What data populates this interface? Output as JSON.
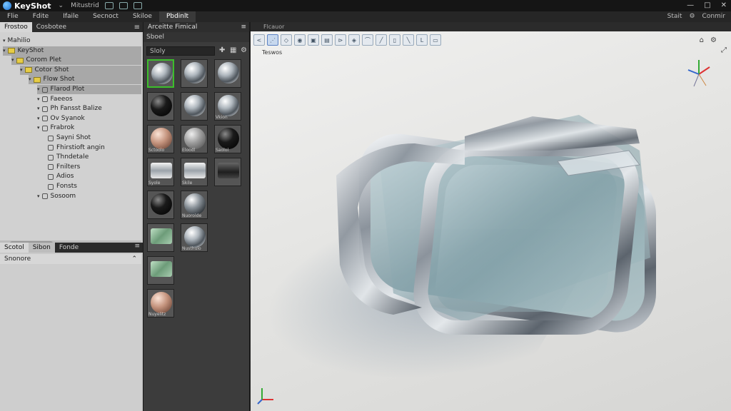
{
  "title_bar": {
    "app_name": "KeyShot",
    "items": [
      "Mitustrid"
    ],
    "right": [
      "□",
      "✕"
    ]
  },
  "menu": {
    "items": [
      "Flie",
      "Fdite",
      "Ifaile",
      "Secnoct",
      "Skiloe",
      "Pbdinlt"
    ],
    "active_index": 5,
    "right": [
      "Stait",
      "Conmir"
    ]
  },
  "scene_panel": {
    "tabs": [
      "Frostoo",
      "Cosbotee"
    ],
    "tree": [
      {
        "label": "Mahilio",
        "level": 0,
        "kind": "text"
      },
      {
        "label": "KeyShot",
        "level": 0,
        "kind": "folder",
        "selected": true
      },
      {
        "label": "Corom Plet",
        "level": 1,
        "kind": "folder",
        "selected": true
      },
      {
        "label": "Cotor Shot",
        "level": 2,
        "kind": "folder",
        "selected": true
      },
      {
        "label": "Flow Shot",
        "level": 3,
        "kind": "folder",
        "selected": true
      },
      {
        "label": "Flarod Plot",
        "level": 4,
        "kind": "item",
        "selected": true
      },
      {
        "label": "Faeeos",
        "level": 4,
        "kind": "item"
      },
      {
        "label": "Ph Fansst Balize",
        "level": 4,
        "kind": "item"
      },
      {
        "label": "Ov Syanok",
        "level": 4,
        "kind": "item"
      },
      {
        "label": "Frabrok",
        "level": 4,
        "kind": "item"
      },
      {
        "label": "Sayni Shot",
        "level": 5,
        "kind": "item"
      },
      {
        "label": "Fhirstioft angin",
        "level": 5,
        "kind": "item"
      },
      {
        "label": "Thndetale",
        "level": 5,
        "kind": "item"
      },
      {
        "label": "Fnilters",
        "level": 5,
        "kind": "item"
      },
      {
        "label": "Adios",
        "level": 5,
        "kind": "item"
      },
      {
        "label": "Fonsts",
        "level": 5,
        "kind": "item"
      },
      {
        "label": "Sosoom",
        "level": 4,
        "kind": "item"
      }
    ],
    "lower_tabs": [
      "Scotol",
      "Sibon",
      "Fonde"
    ],
    "props_title": "Snonore"
  },
  "library": {
    "tab_label": "Arceitte Fimical",
    "sub_label": "Sboel",
    "search_placeholder": "Sloly",
    "materials": [
      {
        "label": "",
        "style": "chrome",
        "selected": true
      },
      {
        "label": "",
        "style": "chrome"
      },
      {
        "label": "",
        "style": "chrome"
      },
      {
        "label": "",
        "style": "black"
      },
      {
        "label": "",
        "style": "chrome"
      },
      {
        "label": "Vkion",
        "style": "chrome"
      },
      {
        "label": "Sctoolo",
        "style": "copper"
      },
      {
        "label": "Eloodl",
        "style": "grey"
      },
      {
        "label": "Saolol",
        "style": "black"
      },
      {
        "label": "Syole",
        "style": "plate"
      },
      {
        "label": "Skile",
        "style": "plate"
      },
      {
        "label": "",
        "style": "darkplate"
      },
      {
        "label": "",
        "style": "black"
      },
      {
        "label": "Nuorolde",
        "style": "stripe"
      },
      {
        "label": "",
        "style": "none"
      },
      {
        "label": "",
        "style": "glass"
      },
      {
        "label": "Nusthulo",
        "style": "chrome"
      },
      {
        "label": "",
        "style": "none"
      },
      {
        "label": "",
        "style": "glass"
      },
      {
        "label": "",
        "style": "none"
      },
      {
        "label": "",
        "style": "none"
      },
      {
        "label": "Nuyelitz",
        "style": "copper"
      }
    ]
  },
  "viewport": {
    "header": "Flcauor",
    "label": "Teswos",
    "tools": [
      "<",
      "⋰",
      "◇",
      "◉",
      "▣",
      "▤",
      "⊳",
      "◈",
      "⌒",
      "╱",
      "▯",
      "╲",
      "L",
      "▭"
    ]
  },
  "colors": {
    "accent_selected": "#3cbf2b",
    "folder": "#e6cc46"
  }
}
